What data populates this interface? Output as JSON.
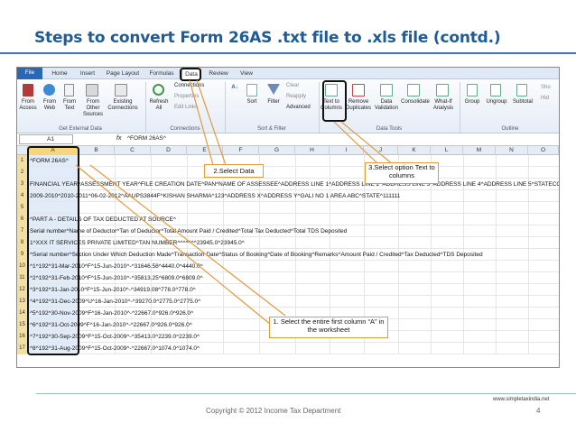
{
  "slide": {
    "title": "Steps to convert Form 26AS .txt file to .xls file (contd.)",
    "copyright": "Copyright © 2012 Income Tax Department",
    "page_number": "4",
    "website": "www.simpletaxindia.net"
  },
  "excel": {
    "tabs": [
      "File",
      "Home",
      "Insert",
      "Page Layout",
      "Formulas",
      "Data",
      "Review",
      "View"
    ],
    "ribbon": {
      "from_access": "From Access",
      "from_web": "From Web",
      "from_text": "From Text",
      "from_other": "From Other Sources",
      "existing": "Existing Connections",
      "get_external": "Get External Data",
      "refresh": "Refresh All",
      "connections": "Connections",
      "properties": "Properties",
      "edit_links": "Edit Links",
      "connections_grp": "Connections",
      "sort": "Sort",
      "filter": "Filter",
      "clear": "Clear",
      "reapply": "Reapply",
      "advanced": "Advanced",
      "sort_filter": "Sort & Filter",
      "text_to_columns": "Text to Columns",
      "remove_duplicates": "Remove Duplicates",
      "data_validation": "Data Validation",
      "consolidate": "Consolidate",
      "what_if": "What-If Analysis",
      "data_tools": "Data Tools",
      "group": "Group",
      "ungroup": "Ungroup",
      "subtotal": "Subtotal",
      "outline": "Outline",
      "show": "Sho",
      "hide": "Hid"
    },
    "name_box": "A1",
    "fx": "fx",
    "formula": "^FORM 26AS^",
    "columns": [
      "A",
      "B",
      "C",
      "D",
      "E",
      "F",
      "G",
      "H",
      "I",
      "J",
      "K",
      "L",
      "M",
      "N",
      "O"
    ],
    "rows": [
      {
        "n": "1",
        "text": "^FORM 26AS^"
      },
      {
        "n": "2",
        "text": ""
      },
      {
        "n": "3",
        "text": "FINANCIAL YEAR^ASSESSMENT YEAR^FILE CREATION DATE^PAN^NAME OF ASSESSEE^ADDRESS LINE 1^ADDRESS LINE 2^ADDRESS LINE 3^ADDRESS LINE 4^ADDRESS LINE 5^STATECO"
      },
      {
        "n": "4",
        "text": "2009-2010^2010-2011^06-02-2012^AAUPS3844F^KISHAN SHARMA^123^ADDRESS X^ADDRESS Y^GALI NO 1 AREA ABC^STATE^111111"
      },
      {
        "n": "5",
        "text": ""
      },
      {
        "n": "6",
        "text": "^PART A - DETAILS OF TAX DEDUCTED AT SOURCE^"
      },
      {
        "n": "7",
        "text": "Serial number^Name of Deductor^Tan of Deductor^Total Amount Paid / Credited^Total Tax Deducted^Total TDS Deposited"
      },
      {
        "n": "8",
        "text": "1^XXX IT SERVICES PRIVATE LIMITED^TAN NUMBER^^^^^^^23945.0^23945.0^"
      },
      {
        "n": "9",
        "text": "^Serial number^Section Under Which Deduction Made^Transaction Date^Status of Booking^Date of Booking^Remarks^Amount Paid / Credited^Tax Deducted^TDS Deposited"
      },
      {
        "n": "10",
        "text": "^1^192^31-Mar-2010^F^15-Jun-2010^-^31646.58^4440.0^4440.0^"
      },
      {
        "n": "11",
        "text": "^2^192^31-Feb-2010^F^15-Jun-2010^-^35813.25^6809.0^6809.0^"
      },
      {
        "n": "12",
        "text": "^3^192^31-Jan-2010^F^15-Jun-2010^-^34919.08^778.0^778.0^"
      },
      {
        "n": "13",
        "text": "^4^192^31-Dec-2009^U^16-Jan-2010^-^39270.0^2775.0^2775.0^"
      },
      {
        "n": "14",
        "text": "^5^192^30-Nov-2009^F^16-Jan-2010^-^22667.0^926.0^926.0^"
      },
      {
        "n": "15",
        "text": "^6^192^31-Oct-2009^F^16-Jan-2010^-^22667.0^926.0^926.0^"
      },
      {
        "n": "16",
        "text": "^7^192^30-Sep-2009^F^15-Oct-2009^-^35413.0^2239.0^2239.0^"
      },
      {
        "n": "17",
        "text": "^8^192^31-Aug-2009^F^15-Oct-2009^-^22667.0^1074.0^1074.0^"
      }
    ]
  },
  "callouts": {
    "select_data": "2.Select Data",
    "select_text": "3.Select option Text to columns",
    "select_column": "1. Select the entire first column “A” in the worksheet"
  }
}
